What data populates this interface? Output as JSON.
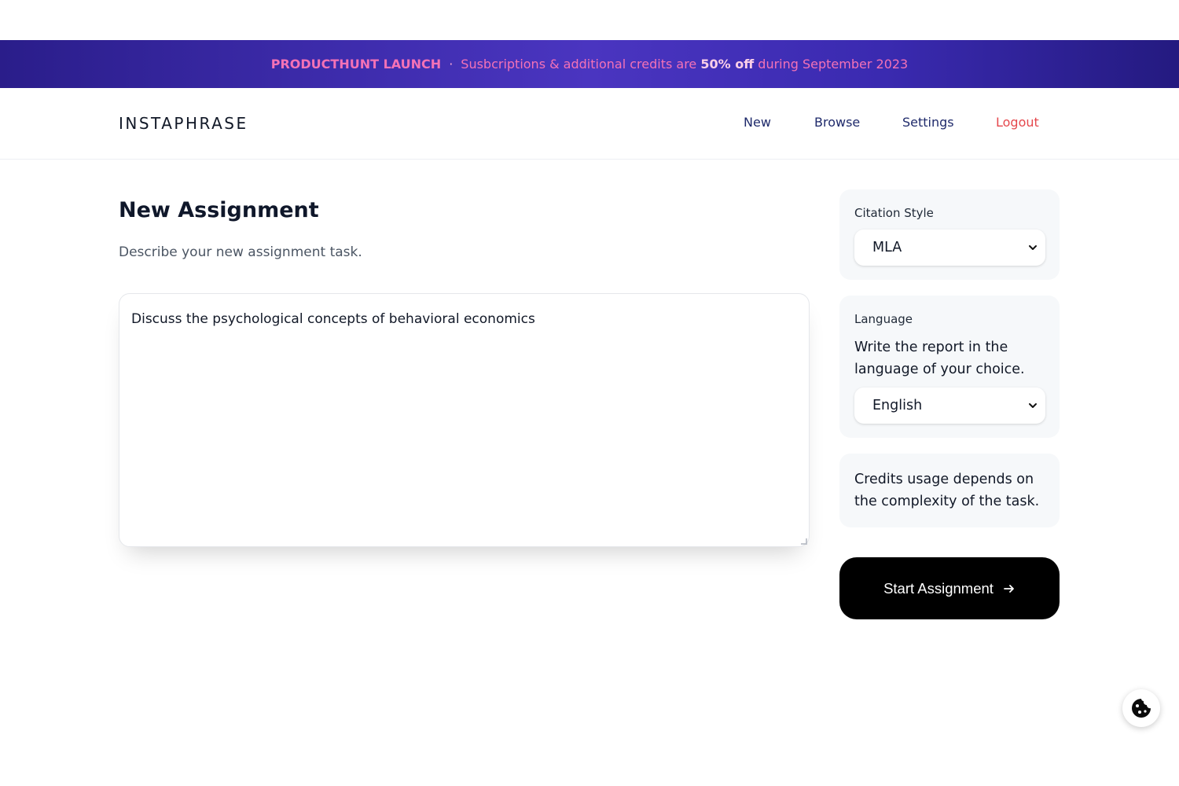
{
  "banner": {
    "launch": "PRODUCTHUNT LAUNCH",
    "separator": "·",
    "text_before": "Susbcriptions & additional credits are",
    "highlight": "50% off",
    "text_after": "during September 2023"
  },
  "header": {
    "logo": "INSTAPHRASE",
    "nav": [
      {
        "label": "New"
      },
      {
        "label": "Browse"
      },
      {
        "label": "Settings"
      },
      {
        "label": "Logout"
      }
    ]
  },
  "main": {
    "title": "New Assignment",
    "subtitle": "Describe your new assignment task.",
    "task_value": "Discuss the psychological concepts of behavioral economics"
  },
  "sidebar": {
    "citation": {
      "label": "Citation Style",
      "selected": "MLA"
    },
    "language": {
      "label": "Language",
      "description": "Write the report in the language of your choice.",
      "selected": "English"
    },
    "credits_note": "Credits usage depends on the complexity of the task.",
    "start_button": "Start Assignment"
  },
  "icons": {
    "chevron": "chevron-down-icon",
    "arrow": "arrow-right-icon",
    "cookie": "cookie-icon"
  },
  "colors": {
    "banner_pink": "#f472b6",
    "nav_blue": "#1f2a6b",
    "logout_red": "#e5484d",
    "button_black": "#000000"
  }
}
